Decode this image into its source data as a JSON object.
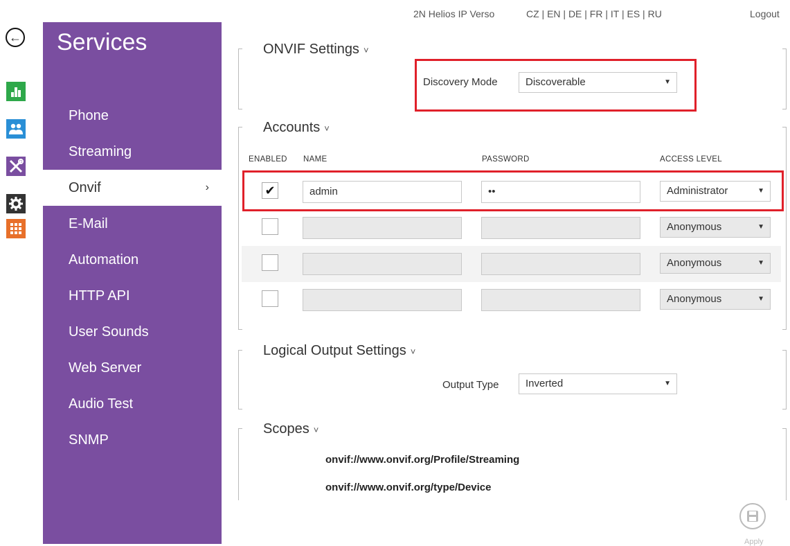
{
  "topbar": {
    "device": "2N Helios IP Verso",
    "languages": "CZ | EN | DE | FR | IT | ES | RU",
    "logout": "Logout"
  },
  "icons": {
    "back": "arrow-left-icon",
    "status": "bar-chart-icon",
    "directory": "users-icon",
    "hardware": "tools-icon",
    "services": "gear-icon",
    "system": "grid-icon"
  },
  "colors": {
    "sidebar": "#7a4ea0",
    "status_icon": "#2ea84a",
    "directory_icon": "#2a8fd6",
    "hardware_icon": "#7a4ea0",
    "services_icon": "#333333",
    "system_icon": "#e8702a",
    "highlight": "#e0202a"
  },
  "sidebar": {
    "title": "Services",
    "items": [
      {
        "label": "Phone"
      },
      {
        "label": "Streaming"
      },
      {
        "label": "Onvif",
        "chevron": "›"
      },
      {
        "label": "E-Mail"
      },
      {
        "label": "Automation"
      },
      {
        "label": "HTTP API"
      },
      {
        "label": "User Sounds"
      },
      {
        "label": "Web Server"
      },
      {
        "label": "Audio Test"
      },
      {
        "label": "SNMP"
      }
    ]
  },
  "onvif_settings": {
    "title": "ONVIF Settings",
    "discovery_label": "Discovery Mode",
    "discovery_value": "Discoverable"
  },
  "accounts": {
    "title": "Accounts",
    "columns": {
      "enabled": "ENABLED",
      "name": "NAME",
      "password": "PASSWORD",
      "access": "ACCESS LEVEL"
    },
    "rows": [
      {
        "enabled": true,
        "check": "✔",
        "name": "admin",
        "password": "••",
        "access": "Administrator"
      },
      {
        "enabled": false,
        "check": "",
        "name": "",
        "password": "",
        "access": "Anonymous"
      },
      {
        "enabled": false,
        "check": "",
        "name": "",
        "password": "",
        "access": "Anonymous"
      },
      {
        "enabled": false,
        "check": "",
        "name": "",
        "password": "",
        "access": "Anonymous"
      }
    ]
  },
  "logical_output": {
    "title": "Logical Output Settings",
    "output_label": "Output Type",
    "output_value": "Inverted"
  },
  "scopes": {
    "title": "Scopes",
    "items": [
      "onvif://www.onvif.org/Profile/Streaming",
      "onvif://www.onvif.org/type/Device"
    ]
  },
  "apply": {
    "label": "Apply"
  },
  "glyphs": {
    "caret": "˅",
    "select_arrow": "▼",
    "back_arrow": "←"
  }
}
